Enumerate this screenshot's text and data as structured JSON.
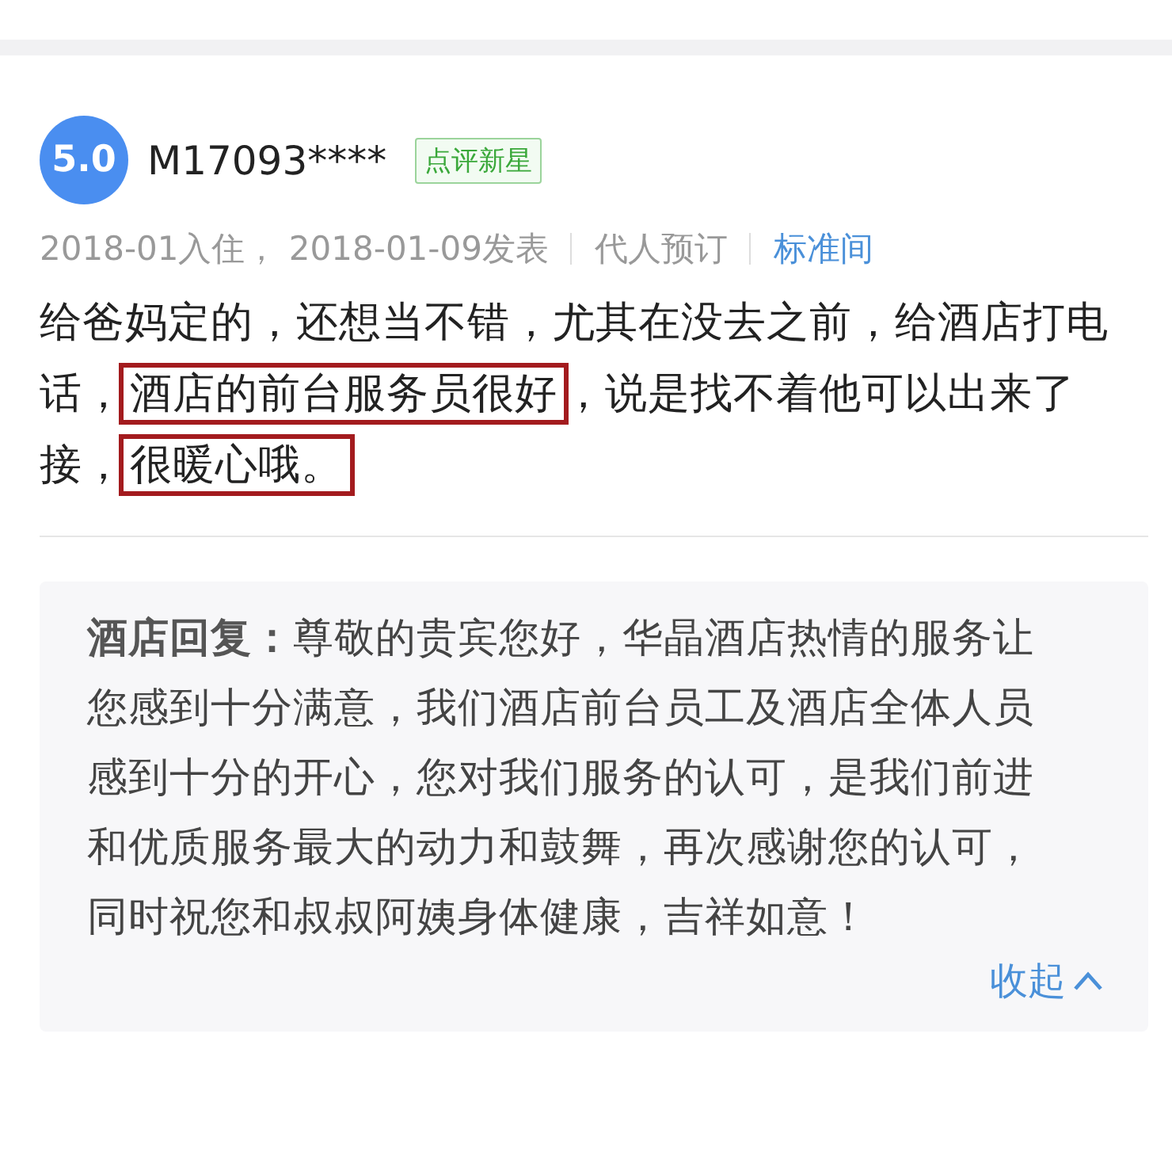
{
  "rating_badge": "5.0",
  "username": "M17093****",
  "user_tag": "点评新星",
  "meta": [
    {
      "text": "2018-01入住， 2018-01-09发表",
      "kind": "plain"
    },
    {
      "text": "代人预订",
      "kind": "plain"
    },
    {
      "text": "标准间",
      "kind": "room"
    }
  ],
  "review": [
    [
      {
        "text": "给爸妈定的，还想当不错，尤其在没去之前，给酒店打电",
        "highlighted": false
      }
    ],
    [
      {
        "text": "话，",
        "highlighted": false
      },
      {
        "text": "酒店的前台服务员很好",
        "highlighted": true
      },
      {
        "text": "，说是找不着他可以出来了",
        "highlighted": false
      }
    ],
    [
      {
        "text": "接，",
        "highlighted": false
      },
      {
        "text": "很暖心哦。",
        "highlighted": true
      }
    ]
  ],
  "reply": {
    "text": "**酒店回复：**尊敬的贵宾您好，华晶酒店热情的服务让您感到十分满意，我们酒店前台员工及酒店全体人员感到十分的开心，您对我们服务的认可，是我们前进和优质服务最大的动力和鼓舞，再次感谢您的认可，同时祝您和叔叔阿姨身体健康，吉祥如意！"
  },
  "collapse": {
    "label": "收起"
  }
}
